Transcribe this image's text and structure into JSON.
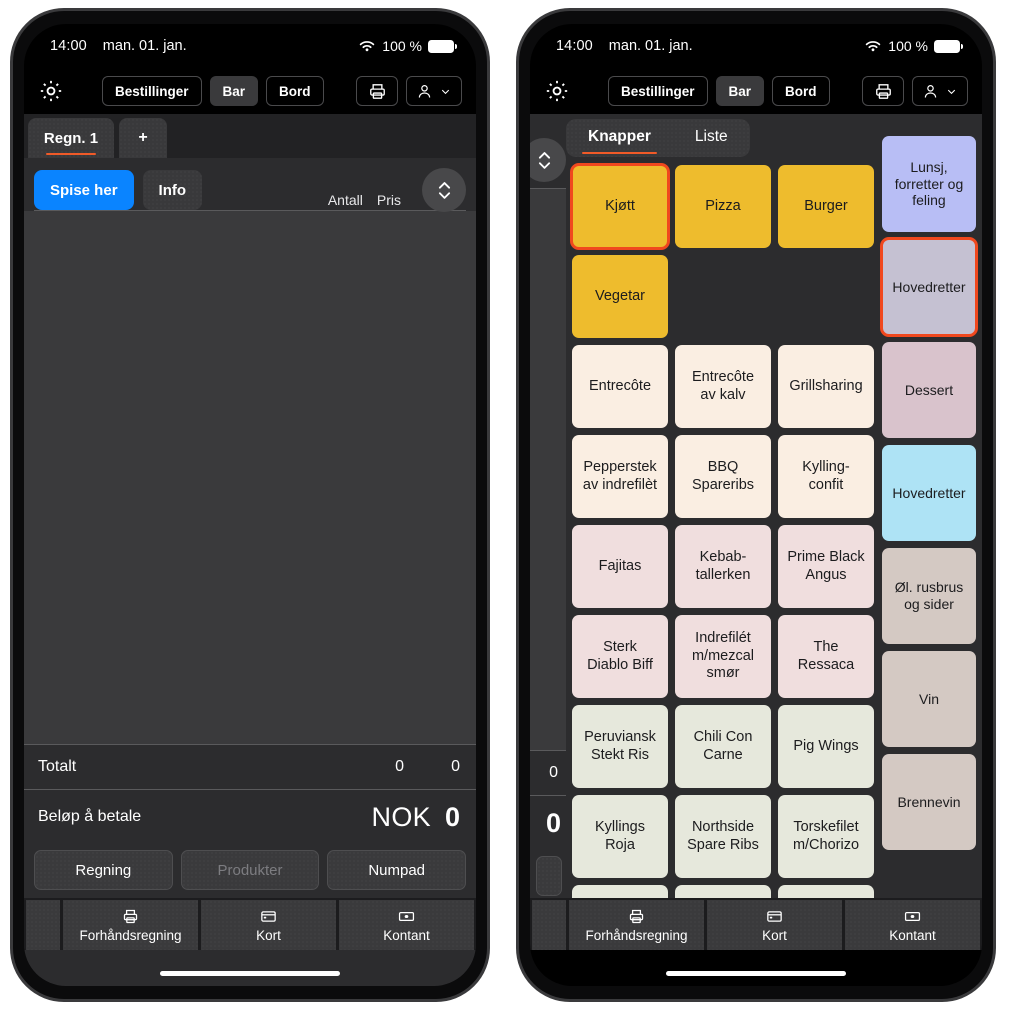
{
  "status_bar": {
    "time": "14:00",
    "date": "man. 01. jan.",
    "battery_percent": "100 %",
    "wifi_icon": "wifi-icon",
    "battery_icon": "battery-icon"
  },
  "toolbar": {
    "settings_icon": "gear-icon",
    "segments": [
      {
        "label": "Bestillinger",
        "active": false
      },
      {
        "label": "Bar",
        "active": true
      },
      {
        "label": "Bord",
        "active": false
      }
    ],
    "print_icon": "printer-icon",
    "user_icon": "person-icon",
    "user_chevron_icon": "chevron-down-icon"
  },
  "left_phone": {
    "bill_tabs": [
      {
        "label": "Regn. 1",
        "selected": true
      },
      {
        "label": "+",
        "selected": false
      }
    ],
    "mode_buttons": [
      {
        "label": "Spise her",
        "primary": true
      },
      {
        "label": "Info",
        "primary": false
      }
    ],
    "column_headers": {
      "qty": "Antall",
      "price": "Pris"
    },
    "stepper_icon": "chevron-up-down-icon",
    "total_row": {
      "label": "Totalt",
      "qty": "0",
      "price": "0"
    },
    "pay_row": {
      "label": "Beløp å betale",
      "currency": "NOK",
      "amount": "0"
    },
    "action_buttons": [
      {
        "label": "Regning",
        "disabled": false
      },
      {
        "label": "Produkter",
        "disabled": true
      },
      {
        "label": "Numpad",
        "disabled": false
      }
    ],
    "bottom_bar": [
      {
        "label": "Forhåndsregning",
        "icon": "printer-icon"
      },
      {
        "label": "Kort",
        "icon": "credit-card-icon"
      },
      {
        "label": "Kontant",
        "icon": "cash-icon"
      }
    ]
  },
  "right_phone": {
    "edge_receipt": {
      "stepper_icon": "chevron-up-down-icon",
      "total_value": "0",
      "pay_value": "0"
    },
    "view_tabs": [
      {
        "label": "Knapper",
        "selected": true
      },
      {
        "label": "Liste",
        "selected": false
      }
    ],
    "tiles": [
      {
        "label": "Kjøtt",
        "color": "#EEBC2D",
        "selected": true
      },
      {
        "label": "Pizza",
        "color": "#EEBC2D",
        "selected": false
      },
      {
        "label": "Burger",
        "color": "#EEBC2D",
        "selected": false
      },
      {
        "label": "Vegetar",
        "color": "#EEBC2D",
        "selected": false
      },
      {
        "label": "",
        "color": "",
        "selected": false
      },
      {
        "label": "",
        "color": "",
        "selected": false
      },
      {
        "label": "Entrecôte",
        "color": "#FAEEE2",
        "selected": false
      },
      {
        "label": "Entrecôte\nav kalv",
        "color": "#FAEEE2",
        "selected": false
      },
      {
        "label": "Grillsharing",
        "color": "#FAEEE2",
        "selected": false
      },
      {
        "label": "Pepperstek\nav indrefilèt",
        "color": "#FAEEE2",
        "selected": false
      },
      {
        "label": "BBQ\nSpareribs",
        "color": "#FAEEE2",
        "selected": false
      },
      {
        "label": "Kylling-\nconfit",
        "color": "#FAEEE2",
        "selected": false
      },
      {
        "label": "Fajitas",
        "color": "#F0DEDE",
        "selected": false
      },
      {
        "label": "Kebab-\ntallerken",
        "color": "#F0DEDE",
        "selected": false
      },
      {
        "label": "Prime Black\nAngus",
        "color": "#F0DEDE",
        "selected": false
      },
      {
        "label": "Sterk\nDiablo Biff",
        "color": "#F0DEDE",
        "selected": false
      },
      {
        "label": "Indrefilét\nm/mezcal\nsmør",
        "color": "#F0DEDE",
        "selected": false
      },
      {
        "label": "The\nRessaca",
        "color": "#F0DEDE",
        "selected": false
      },
      {
        "label": "Peruviansk\nStekt Ris",
        "color": "#E6E8DC",
        "selected": false
      },
      {
        "label": "Chili Con\nCarne",
        "color": "#E6E8DC",
        "selected": false
      },
      {
        "label": "Pig Wings",
        "color": "#E6E8DC",
        "selected": false
      },
      {
        "label": "Kyllings\nRoja",
        "color": "#E6E8DC",
        "selected": false
      },
      {
        "label": "Northside\nSpare Ribs",
        "color": "#E6E8DC",
        "selected": false
      },
      {
        "label": "Torskefilet\nm/Chorizo",
        "color": "#E6E8DC",
        "selected": false
      },
      {
        "label": "",
        "color": "#E6E8DC",
        "selected": false
      },
      {
        "label": "",
        "color": "#E6E8DC",
        "selected": false
      },
      {
        "label": "",
        "color": "#E6E8DC",
        "selected": false
      }
    ],
    "categories": [
      {
        "label": "Lunsj,\nforretter og\nfeling",
        "color": "#B8BEF5",
        "selected": false
      },
      {
        "label": "Hovedretter",
        "color": "#C5C1D2",
        "selected": true
      },
      {
        "label": "Dessert",
        "color": "#D9C3CC",
        "selected": false
      },
      {
        "label": "Hovedretter",
        "color": "#AEE3F5",
        "selected": false
      },
      {
        "label": "Øl. rusbrus\nog sider",
        "color": "#D4C9C3",
        "selected": false
      },
      {
        "label": "Vin",
        "color": "#D4C9C3",
        "selected": false
      },
      {
        "label": "Brennevin",
        "color": "#D4C9C3",
        "selected": false
      }
    ],
    "bottom_bar": [
      {
        "label": "Forhåndsregning",
        "icon": "printer-icon"
      },
      {
        "label": "Kort",
        "icon": "credit-card-icon"
      },
      {
        "label": "Kontant",
        "icon": "cash-icon"
      }
    ]
  },
  "colors": {
    "accent_orange": "#F0481E",
    "tab_underline": "#F05A28",
    "primary_blue": "#0A84FF",
    "panel_bg": "#2C2C2E",
    "screen_bg": "#1C1C1E"
  }
}
